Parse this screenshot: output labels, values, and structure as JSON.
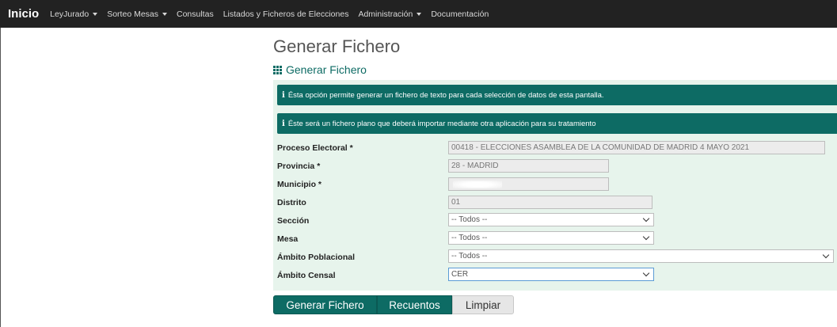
{
  "navbar": {
    "brand": "Inicio",
    "items": [
      {
        "label": "LeyJurado",
        "dropdown": true
      },
      {
        "label": "Sorteo Mesas",
        "dropdown": true
      },
      {
        "label": "Consultas",
        "dropdown": false
      },
      {
        "label": "Listados y Ficheros de Elecciones",
        "dropdown": false
      },
      {
        "label": "Administración",
        "dropdown": true
      },
      {
        "label": "Documentación",
        "dropdown": false
      }
    ]
  },
  "page": {
    "title": "Generar Fichero",
    "subtitle": "Generar Fichero"
  },
  "info": [
    {
      "icon": "i",
      "text": "Ésta opción permite generar un fichero de texto para cada selección de datos de esta pantalla."
    },
    {
      "icon": "i",
      "text": "Éste será un fichero plano que deberá importar mediante otra aplicación para su tratamiento"
    }
  ],
  "form": {
    "proceso": {
      "label": "Proceso Electoral *",
      "value": "00418 - ELECCIONES ASAMBLEA DE LA COMUNIDAD DE MADRID 4 MAYO 2021"
    },
    "provincia": {
      "label": "Provincia *",
      "value": "28 - MADRID"
    },
    "municipio": {
      "label": "Municipio *",
      "value": ""
    },
    "distrito": {
      "label": "Distrito",
      "value": "01"
    },
    "seccion": {
      "label": "Sección",
      "value": "-- Todos --"
    },
    "mesa": {
      "label": "Mesa",
      "value": "-- Todos --"
    },
    "ambito_poblacional": {
      "label": "Ámbito Poblacional",
      "value": "-- Todos --"
    },
    "ambito_censal": {
      "label": "Ámbito Censal",
      "value": "CER"
    }
  },
  "buttons": {
    "generar": "Generar Fichero",
    "recuentos": "Recuentos",
    "limpiar": "Limpiar"
  },
  "colors": {
    "accent": "#0d6b64",
    "panel": "#e7f4ec",
    "navbar": "#222222"
  }
}
